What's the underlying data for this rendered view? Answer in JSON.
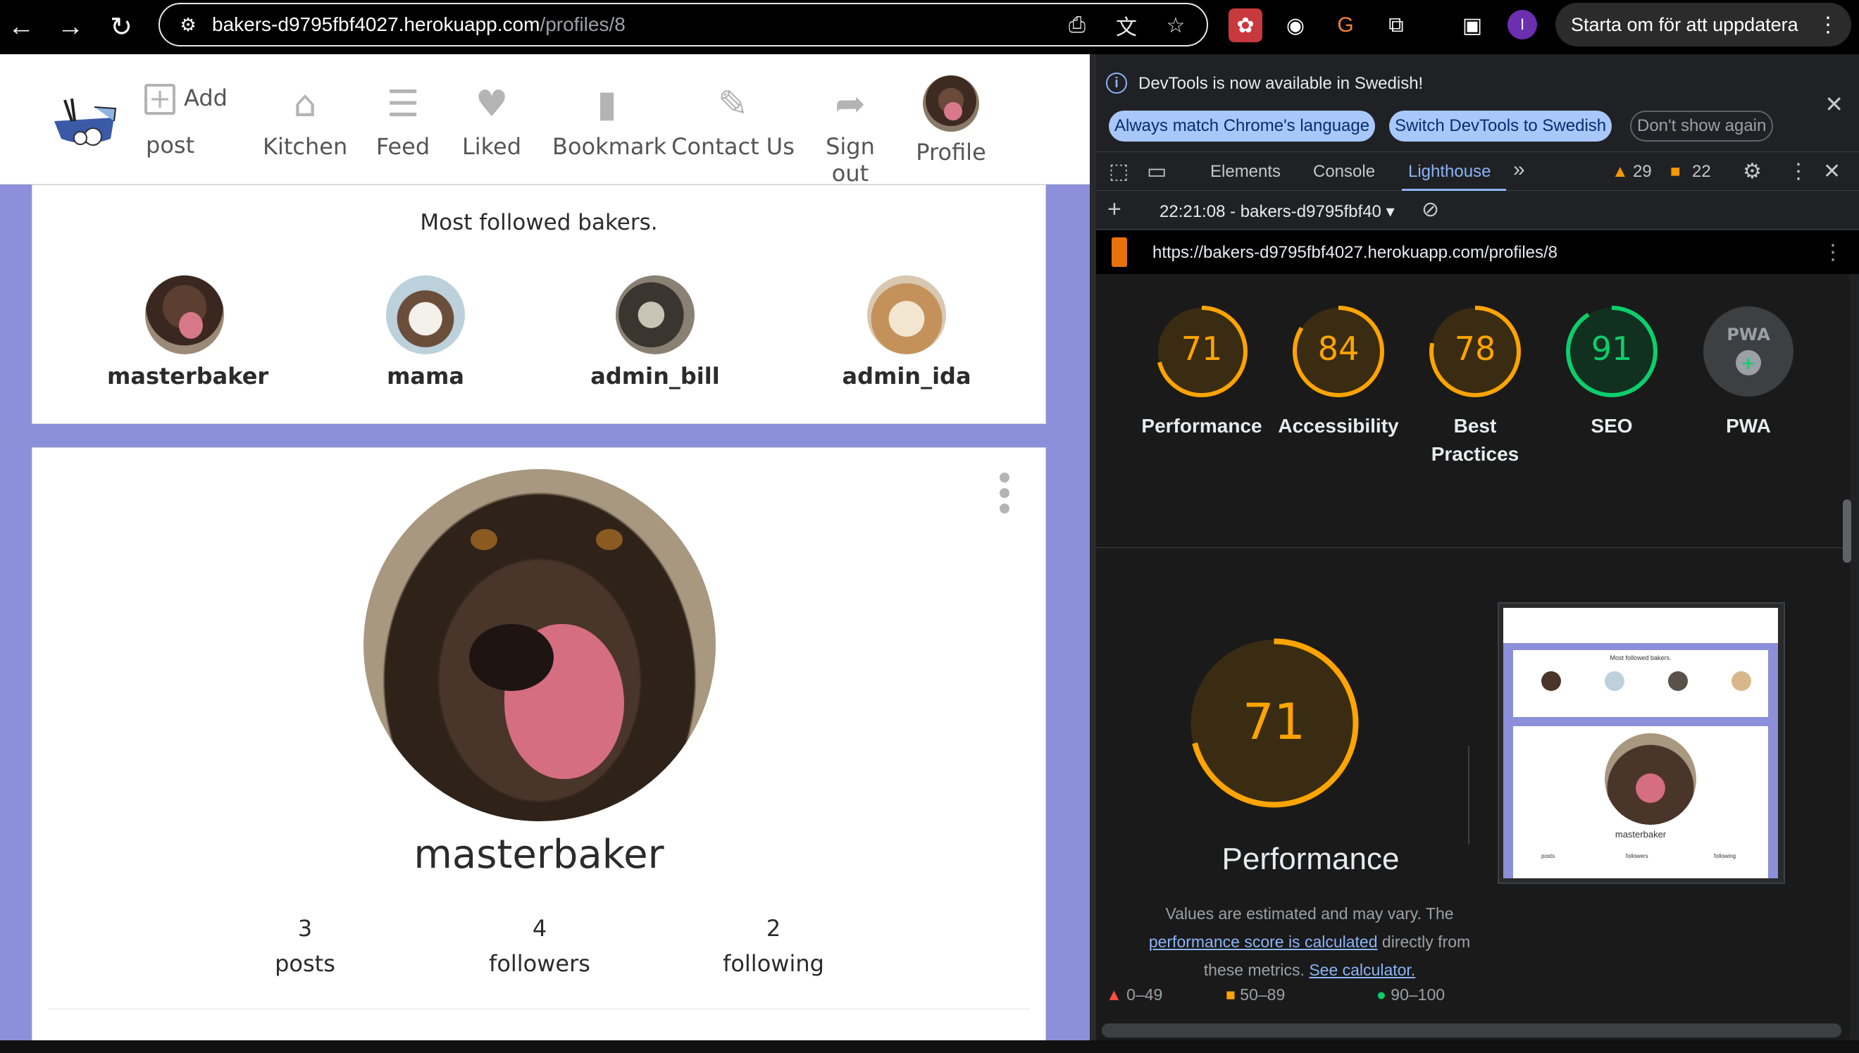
{
  "browser": {
    "url_host": "bakers-d9795fbf4027.herokuapp.com",
    "url_path": "/profiles/8",
    "restart_label": "Starta om för att uppdatera",
    "profile_initial": "I"
  },
  "site_nav": {
    "add_label": "Add",
    "post_label": "post",
    "items": [
      {
        "label": "Kitchen",
        "icon": "home-icon"
      },
      {
        "label": "Feed",
        "icon": "feed-icon"
      },
      {
        "label": "Liked",
        "icon": "heart-icon"
      },
      {
        "label": "Bookmark",
        "icon": "bookmark-icon"
      },
      {
        "label": "Contact Us",
        "icon": "pencil-icon"
      },
      {
        "label": "Sign out",
        "icon": "sign-out-icon"
      },
      {
        "label": "Profile",
        "icon": "avatar"
      }
    ]
  },
  "followed": {
    "title": "Most followed bakers.",
    "bakers": [
      "masterbaker",
      "mama",
      "admin_bill",
      "admin_ida"
    ]
  },
  "profile": {
    "name": "masterbaker",
    "stats": [
      {
        "value": "3",
        "label": "posts"
      },
      {
        "value": "4",
        "label": "followers"
      },
      {
        "value": "2",
        "label": "following"
      }
    ]
  },
  "devtools": {
    "banner_message": "DevTools is now available in Swedish!",
    "btn_match": "Always match Chrome's language",
    "btn_switch": "Switch DevTools to Swedish",
    "btn_dont_show": "Don't show again",
    "tabs": [
      "Elements",
      "Console",
      "Lighthouse"
    ],
    "active_tab": "Lighthouse",
    "warnings": "29",
    "issues": "22",
    "report_label": "22:21:08 - bakers-d9795fbf40",
    "report_url": "https://bakers-d9795fbf4027.herokuapp.com/profiles/8"
  },
  "lighthouse": {
    "scores": [
      {
        "value": "71",
        "label": "Performance",
        "color": "#ffa400"
      },
      {
        "value": "84",
        "label": "Accessibility",
        "color": "#ffa400"
      },
      {
        "value": "78",
        "label": "Best Practices",
        "color": "#ffa400"
      },
      {
        "value": "91",
        "label": "SEO",
        "color": "#0cce6b"
      },
      {
        "value": "PWA",
        "label": "PWA",
        "color": "#5f6368"
      }
    ],
    "big_score": "71",
    "big_label": "Performance",
    "desc_1": "Values are estimated and may vary. The",
    "desc_link": "performance score is calculated",
    "desc_2": "directly from",
    "desc_3": "these metrics.",
    "desc_link2": "See calculator.",
    "legend": [
      "0–49",
      "50–89",
      "90–100"
    ],
    "thumb_title": "Most followed bakers.",
    "thumb_name": "masterbaker",
    "thumb_stats": [
      "posts",
      "followers",
      "following"
    ]
  }
}
